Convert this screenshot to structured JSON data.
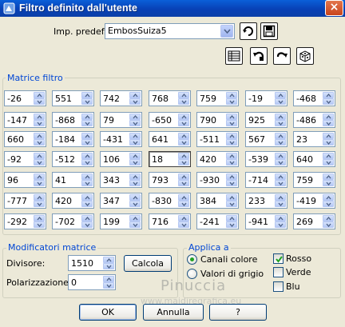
{
  "window": {
    "title": "Filtro definito dall'utente",
    "close": "×"
  },
  "preset": {
    "label": "Imp. predef.:",
    "value": "EmbosSuiza5"
  },
  "matrix": {
    "title": "Matrice filtro",
    "rows": [
      [
        "-26",
        "551",
        "742",
        "768",
        "759",
        "-19",
        "-468"
      ],
      [
        "-147",
        "-868",
        "79",
        "-650",
        "790",
        "925",
        "-486"
      ],
      [
        "660",
        "-184",
        "-431",
        "641",
        "-511",
        "567",
        "23"
      ],
      [
        "-92",
        "-512",
        "106",
        "18",
        "420",
        "-539",
        "640"
      ],
      [
        "96",
        "41",
        "343",
        "793",
        "-930",
        "-714",
        "759"
      ],
      [
        "-777",
        "420",
        "347",
        "-830",
        "384",
        "233",
        "-419"
      ],
      [
        "-292",
        "-702",
        "199",
        "716",
        "-241",
        "-941",
        "269"
      ]
    ],
    "selected_cell": "3-3"
  },
  "modifiers": {
    "title": "Modificatori matrice",
    "divisor_label": "Divisore:",
    "divisor_value": "1510",
    "bias_label": "Polarizzazione:",
    "bias_value": "0",
    "calc_label": "Calcola"
  },
  "apply": {
    "title": "Applica a",
    "radio_color": "Canali colore",
    "radio_gray": "Valori di grigio",
    "selected": "color",
    "red": "Rosso",
    "red_checked": true,
    "green": "Verde",
    "green_checked": false,
    "blue": "Blu",
    "blue_checked": false
  },
  "watermark": {
    "name": "Pinuccia",
    "url": "www.maidiregrafica.eu"
  },
  "buttons": {
    "ok": "OK",
    "cancel": "Annulla",
    "help": "?"
  },
  "colors": {
    "titlebar": "#0a5fd8",
    "group_title": "#0046d5",
    "check": "#21a121"
  }
}
